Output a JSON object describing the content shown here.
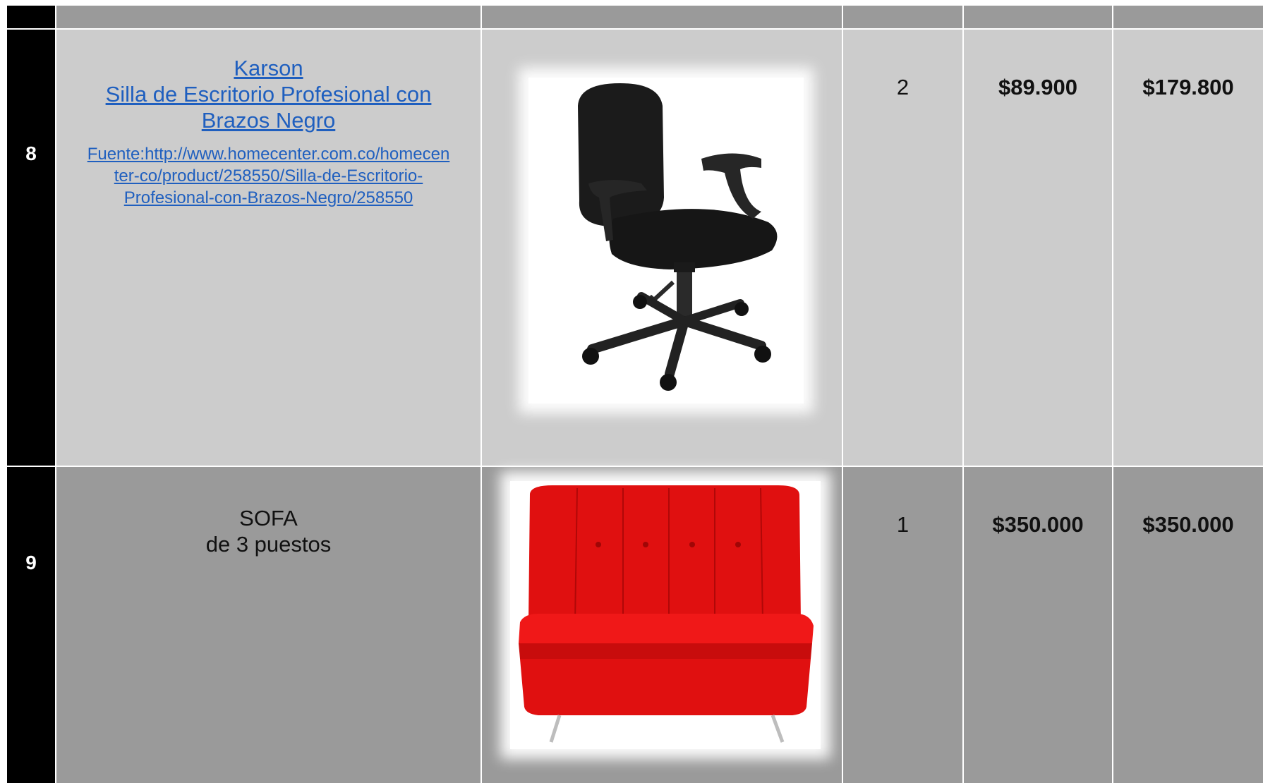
{
  "table": {
    "rows": [
      {
        "number": "8",
        "title_lines": [
          "Karson",
          "Silla de Escritorio Profesional con",
          "Brazos Negro"
        ],
        "source_lines": [
          "Fuente:http://www.homecenter.com.co/homecen",
          "ter-co/product/258550/Silla-de-Escritorio-",
          "Profesional-con-Brazos-Negro/258550"
        ],
        "image": "office-chair-black",
        "quantity": "2",
        "unit_price": "$89.900",
        "total": "$179.800"
      },
      {
        "number": "9",
        "title_lines": [
          "SOFA",
          "de 3 puestos"
        ],
        "image": "sofa-red",
        "quantity": "1",
        "unit_price": "$350.000",
        "total": "$350.000"
      }
    ]
  },
  "colors": {
    "header_gray": "#9a9a9a",
    "row_light": "#cccccc",
    "row_dark": "#9a9a9a",
    "number_col": "#000000",
    "link": "#1f5fbf",
    "sofa_red": "#e01010"
  }
}
